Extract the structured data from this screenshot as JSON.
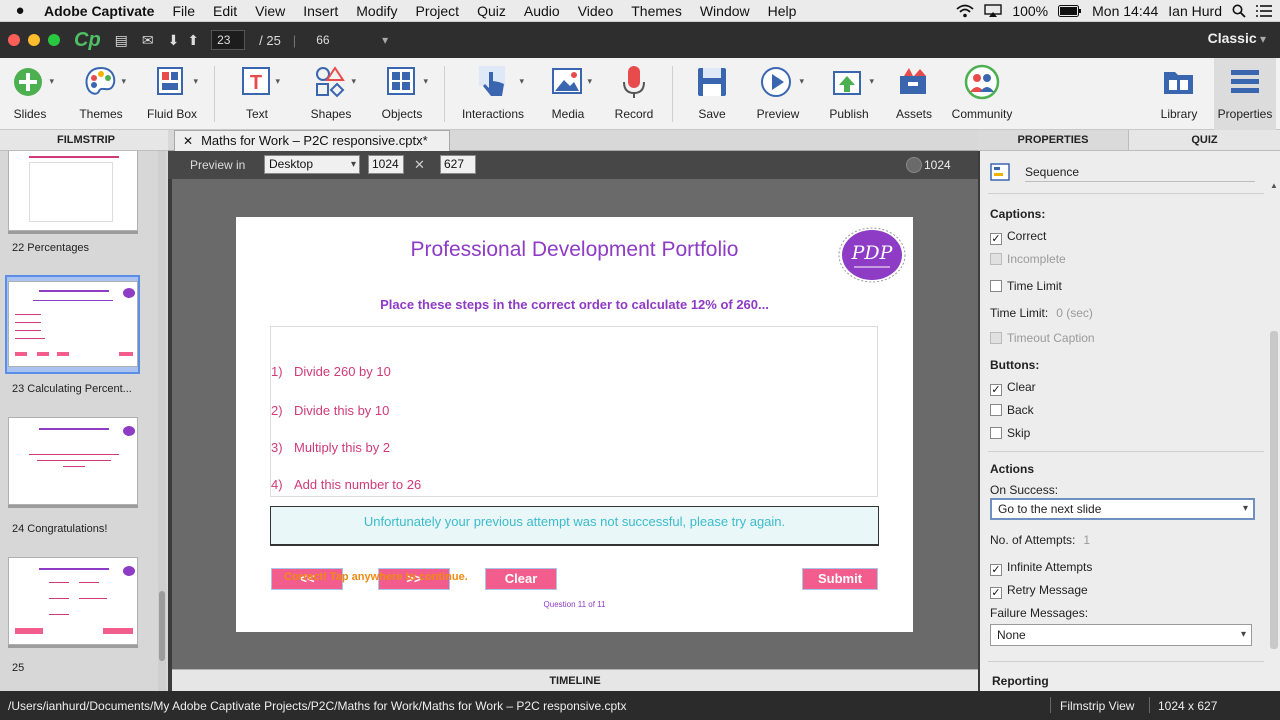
{
  "menubar": {
    "app_name": "Adobe Captivate",
    "items": [
      "File",
      "Edit",
      "View",
      "Insert",
      "Modify",
      "Project",
      "Quiz",
      "Audio",
      "Video",
      "Themes",
      "Window",
      "Help"
    ],
    "battery": "100%",
    "clock": "Mon 14:44",
    "user": "Ian Hurd"
  },
  "titlebar": {
    "logo": "Cp",
    "slide_number": "23",
    "slide_total": "/  25",
    "zoom": "66",
    "workspace": "Classic"
  },
  "toolbar": {
    "slides": "Slides",
    "themes": "Themes",
    "fluid_box": "Fluid Box",
    "text": "Text",
    "shapes": "Shapes",
    "objects": "Objects",
    "interactions": "Interactions",
    "media": "Media",
    "record": "Record",
    "save": "Save",
    "preview": "Preview",
    "publish": "Publish",
    "assets": "Assets",
    "community": "Community",
    "library": "Library",
    "properties": "Properties"
  },
  "filmstrip": {
    "header": "FILMSTRIP",
    "slides": [
      {
        "label": "22 Percentages"
      },
      {
        "label": "23 Calculating Percent..."
      },
      {
        "label": "24 Congratulations!"
      },
      {
        "label": "25"
      }
    ]
  },
  "document": {
    "tab_title": "Maths for Work – P2C responsive.cptx*",
    "preview_in_label": "Preview in",
    "preview_device": "Desktop",
    "preview_width": "1024",
    "preview_height": "627",
    "breakpoint_width": "1024",
    "timeline_label": "TIMELINE"
  },
  "slide": {
    "title": "Professional Development Portfolio",
    "logo_text": "PDP",
    "question": "Place these steps in the correct order to calculate 12% of 260...",
    "steps": [
      {
        "num": "1)",
        "text": "Divide 260 by 10"
      },
      {
        "num": "2)",
        "text": "Divide this by 10"
      },
      {
        "num": "3)",
        "text": "Multiply this by 2"
      },
      {
        "num": "4)",
        "text": "Add this number to 26"
      }
    ],
    "failure_message": "Unfortunately your previous attempt was not successful, please try again.",
    "overlay_caption": "Correct! Tap anywhere to continue.",
    "back_button": "<<",
    "next_button": ">>",
    "clear_button": "Clear",
    "submit_button": "Submit",
    "question_count": "Question 11 of 11"
  },
  "properties": {
    "tab_properties": "PROPERTIES",
    "tab_quiz": "QUIZ",
    "object_name": "Sequence",
    "captions_label": "Captions:",
    "correct": "Correct",
    "incomplete": "Incomplete",
    "time_limit": "Time Limit",
    "time_limit_label": "Time Limit:",
    "time_limit_value": "0 (sec)",
    "timeout_caption": "Timeout Caption",
    "buttons_label": "Buttons:",
    "clear": "Clear",
    "back": "Back",
    "skip": "Skip",
    "actions_label": "Actions",
    "on_success_label": "On Success:",
    "on_success_value": "Go to the next slide",
    "attempts_label": "No. of Attempts:",
    "attempts_value": "1",
    "infinite_attempts": "Infinite Attempts",
    "retry_message": "Retry Message",
    "failure_messages_label": "Failure Messages:",
    "failure_messages_value": "None",
    "reporting_label": "Reporting"
  },
  "statusbar": {
    "path": "/Users/ianhurd/Documents/My Adobe Captivate Projects/P2C/Maths for Work/Maths for Work – P2C responsive.cptx",
    "view": "Filmstrip View",
    "dimensions": "1024 x 627"
  },
  "colors": {
    "accent_purple": "#8e3bc6",
    "step_pink": "#d03a79",
    "button_pink": "#f25d8e",
    "message_cyan": "#3bbccc",
    "cp_green": "#4fbf64"
  }
}
